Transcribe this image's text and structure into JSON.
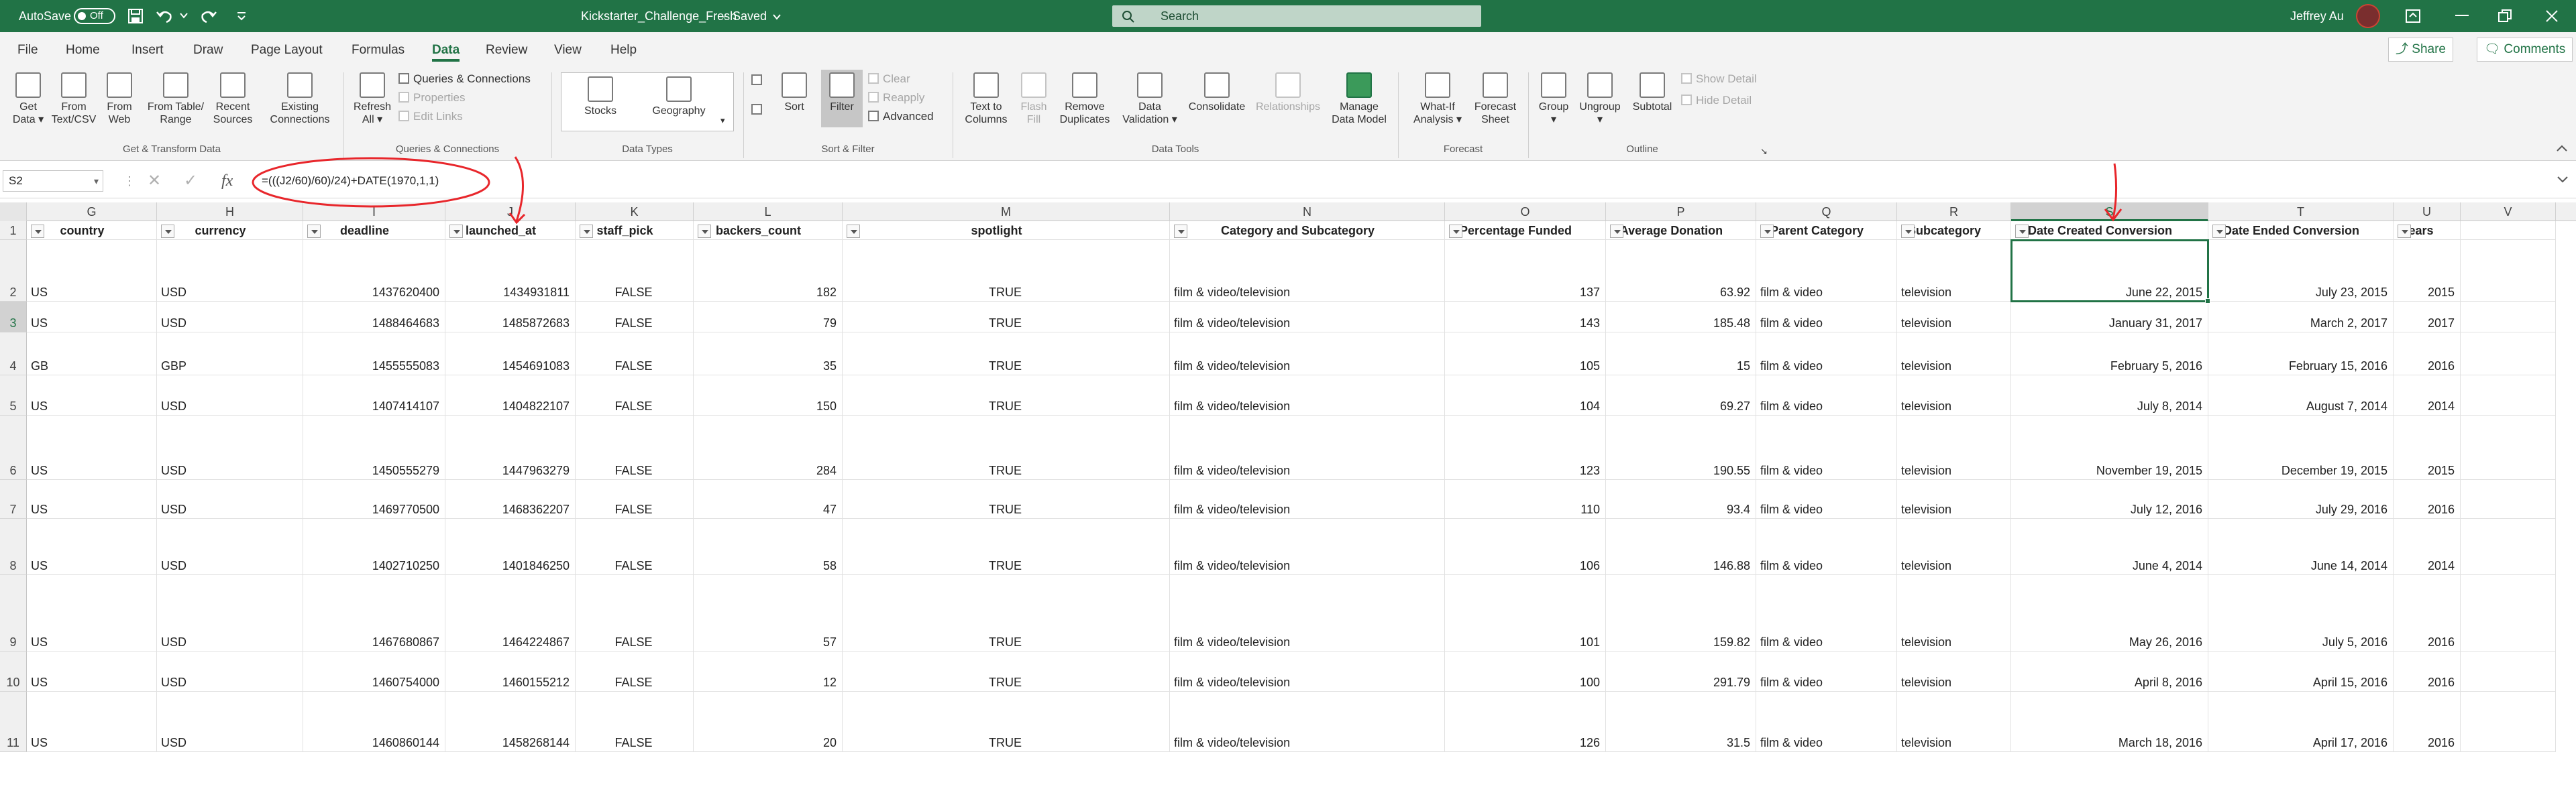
{
  "title_bar": {
    "autosave_label": "AutoSave",
    "autosave_state": "Off",
    "document_title": "Kickstarter_Challenge_Fresh",
    "saved_status": "Saved",
    "search_placeholder": "Search",
    "user_name": "Jeffrey Au",
    "theme_color": "#217346"
  },
  "menu": {
    "tabs": [
      "File",
      "Home",
      "Insert",
      "Draw",
      "Page Layout",
      "Formulas",
      "Data",
      "Review",
      "View",
      "Help"
    ],
    "active_tab": "Data",
    "share_label": "Share",
    "comments_label": "Comments"
  },
  "ribbon": {
    "get_data": [
      "Get",
      "Data"
    ],
    "from_text_csv": [
      "From",
      "Text/CSV"
    ],
    "from_web": [
      "From",
      "Web"
    ],
    "from_table_range": [
      "From Table/",
      "Range"
    ],
    "recent_sources": [
      "Recent",
      "Sources"
    ],
    "existing_connections": [
      "Existing",
      "Connections"
    ],
    "group_get_transform": "Get & Transform Data",
    "refresh_all": [
      "Refresh",
      "All"
    ],
    "queries_connections": "Queries & Connections",
    "properties": "Properties",
    "edit_links": "Edit Links",
    "group_queries": "Queries & Connections",
    "stocks": "Stocks",
    "geography": "Geography",
    "group_data_types": "Data Types",
    "sort": "Sort",
    "filter": "Filter",
    "clear": "Clear",
    "reapply": "Reapply",
    "advanced": "Advanced",
    "group_sort_filter": "Sort & Filter",
    "text_to_columns": [
      "Text to",
      "Columns"
    ],
    "flash_fill": [
      "Flash",
      "Fill"
    ],
    "remove_duplicates": [
      "Remove",
      "Duplicates"
    ],
    "data_validation": [
      "Data",
      "Validation"
    ],
    "consolidate": "Consolidate",
    "relationships": "Relationships",
    "manage_data_model": [
      "Manage",
      "Data Model"
    ],
    "group_data_tools": "Data Tools",
    "what_if": [
      "What-If",
      "Analysis"
    ],
    "forecast_sheet": [
      "Forecast",
      "Sheet"
    ],
    "group_forecast": "Forecast",
    "group": "Group",
    "ungroup": "Ungroup",
    "subtotal": "Subtotal",
    "show_detail": "Show Detail",
    "hide_detail": "Hide Detail",
    "group_outline": "Outline"
  },
  "formula_bar": {
    "name_box": "S2",
    "formula": "=(((J2/60)/60)/24)+DATE(1970,1,1)",
    "annotation_color": "#e8262b"
  },
  "sheet": {
    "column_letters": [
      "G",
      "H",
      "I",
      "J",
      "K",
      "L",
      "M",
      "N",
      "O",
      "P",
      "Q",
      "R",
      "S",
      "T",
      "U",
      "V"
    ],
    "headers": [
      "country",
      "currency",
      "deadline",
      "launched_at",
      "staff_pick",
      "backers_count",
      "spotlight",
      "Category and Subcategory",
      "Percentage Funded",
      "Average Donation",
      "Parent Category",
      "Subcategory",
      "Date Created Conversion",
      "Date Ended Conversion",
      "Years",
      ""
    ],
    "row_numbers": [
      "1",
      "2",
      "3",
      "4",
      "5",
      "6",
      "7",
      "8",
      "9",
      "10",
      "11"
    ],
    "rows": [
      [
        "US",
        "USD",
        "1437620400",
        "1434931811",
        "FALSE",
        "182",
        "TRUE",
        "film & video/television",
        "137",
        "63.92",
        "film & video",
        "television",
        "June 22, 2015",
        "July 23, 2015",
        "2015",
        ""
      ],
      [
        "US",
        "USD",
        "1488464683",
        "1485872683",
        "FALSE",
        "79",
        "TRUE",
        "film & video/television",
        "143",
        "185.48",
        "film & video",
        "television",
        "January 31, 2017",
        "March 2, 2017",
        "2017",
        ""
      ],
      [
        "GB",
        "GBP",
        "1455555083",
        "1454691083",
        "FALSE",
        "35",
        "TRUE",
        "film & video/television",
        "105",
        "15",
        "film & video",
        "television",
        "February 5, 2016",
        "February 15, 2016",
        "2016",
        ""
      ],
      [
        "US",
        "USD",
        "1407414107",
        "1404822107",
        "FALSE",
        "150",
        "TRUE",
        "film & video/television",
        "104",
        "69.27",
        "film & video",
        "television",
        "July 8, 2014",
        "August 7, 2014",
        "2014",
        ""
      ],
      [
        "US",
        "USD",
        "1450555279",
        "1447963279",
        "FALSE",
        "284",
        "TRUE",
        "film & video/television",
        "123",
        "190.55",
        "film & video",
        "television",
        "November 19, 2015",
        "December 19, 2015",
        "2015",
        ""
      ],
      [
        "US",
        "USD",
        "1469770500",
        "1468362207",
        "FALSE",
        "47",
        "TRUE",
        "film & video/television",
        "110",
        "93.4",
        "film & video",
        "television",
        "July 12, 2016",
        "July 29, 2016",
        "2016",
        ""
      ],
      [
        "US",
        "USD",
        "1402710250",
        "1401846250",
        "FALSE",
        "58",
        "TRUE",
        "film & video/television",
        "106",
        "146.88",
        "film & video",
        "television",
        "June 4, 2014",
        "June 14, 2014",
        "2014",
        ""
      ],
      [
        "US",
        "USD",
        "1467680867",
        "1464224867",
        "FALSE",
        "57",
        "TRUE",
        "film & video/television",
        "101",
        "159.82",
        "film & video",
        "television",
        "May 26, 2016",
        "July 5, 2016",
        "2016",
        ""
      ],
      [
        "US",
        "USD",
        "1460754000",
        "1460155212",
        "FALSE",
        "12",
        "TRUE",
        "film & video/television",
        "100",
        "291.79",
        "film & video",
        "television",
        "April 8, 2016",
        "April 15, 2016",
        "2016",
        ""
      ],
      [
        "US",
        "USD",
        "1460860144",
        "1458268144",
        "FALSE",
        "20",
        "TRUE",
        "film & video/television",
        "126",
        "31.5",
        "film & video",
        "television",
        "March 18, 2016",
        "April 17, 2016",
        "2016",
        ""
      ]
    ]
  }
}
